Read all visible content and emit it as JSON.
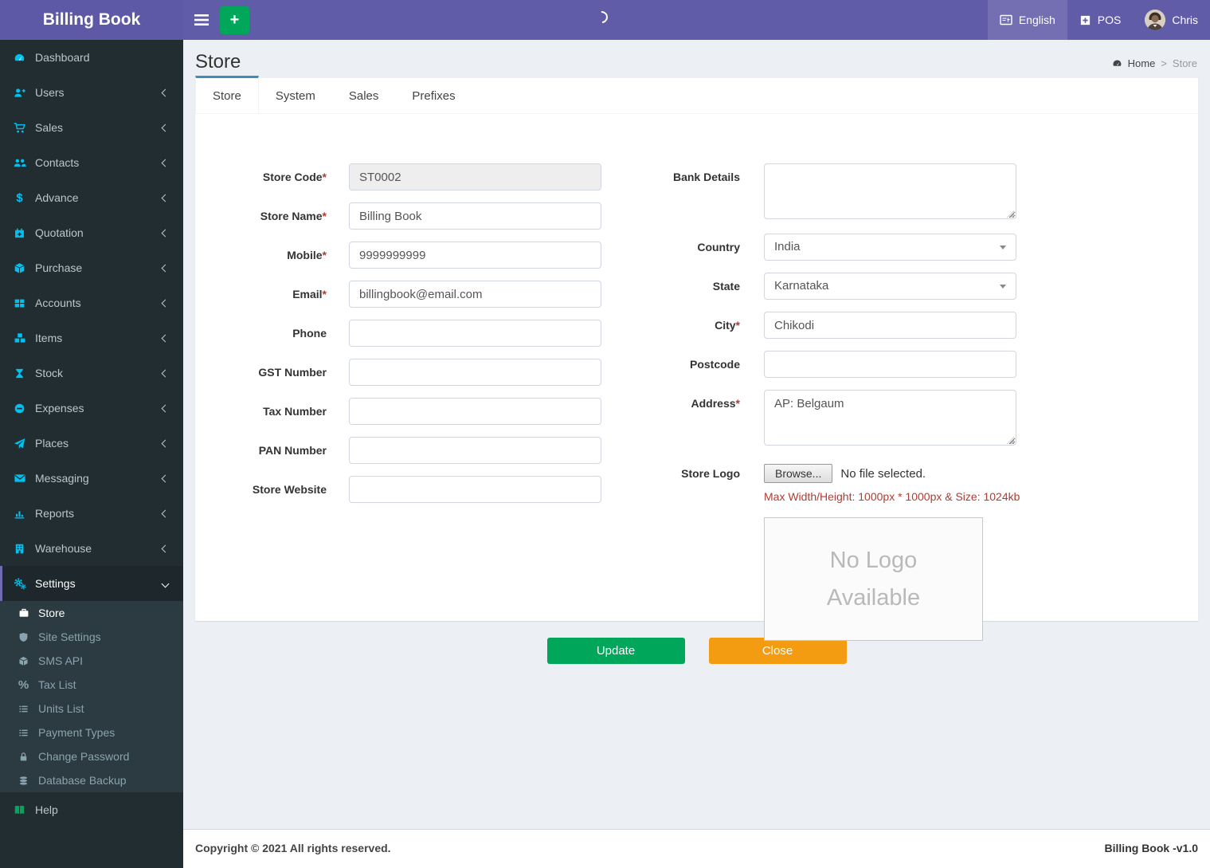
{
  "app": {
    "name": "Billing Book"
  },
  "header": {
    "language": {
      "label": "English",
      "icon": "language-icon"
    },
    "pos": {
      "label": "POS",
      "icon": "plus-square-icon"
    },
    "user": {
      "name": "Chris",
      "icon": "user-avatar"
    }
  },
  "sidebar": {
    "items": [
      {
        "label": "Dashboard",
        "icon": "tachometer-icon"
      },
      {
        "label": "Users",
        "icon": "user-plus-icon"
      },
      {
        "label": "Sales",
        "icon": "cart-icon"
      },
      {
        "label": "Contacts",
        "icon": "users-icon"
      },
      {
        "label": "Advance",
        "icon": "dollar-icon"
      },
      {
        "label": "Quotation",
        "icon": "calendar-plus-icon"
      },
      {
        "label": "Purchase",
        "icon": "cube-icon"
      },
      {
        "label": "Accounts",
        "icon": "grid-icon"
      },
      {
        "label": "Items",
        "icon": "cubes-icon"
      },
      {
        "label": "Stock",
        "icon": "hourglass-icon"
      },
      {
        "label": "Expenses",
        "icon": "minus-circle-icon"
      },
      {
        "label": "Places",
        "icon": "paper-plane-icon"
      },
      {
        "label": "Messaging",
        "icon": "envelope-icon"
      },
      {
        "label": "Reports",
        "icon": "bar-chart-icon"
      },
      {
        "label": "Warehouse",
        "icon": "building-icon"
      },
      {
        "label": "Settings",
        "icon": "gears-icon",
        "active": true,
        "expanded": true
      }
    ],
    "settings_submenu": [
      {
        "label": "Store",
        "icon": "briefcase-icon",
        "active": true
      },
      {
        "label": "Site Settings",
        "icon": "shield-icon"
      },
      {
        "label": "SMS API",
        "icon": "cube-icon"
      },
      {
        "label": "Tax List",
        "icon": "percent-icon"
      },
      {
        "label": "Units List",
        "icon": "list-icon"
      },
      {
        "label": "Payment Types",
        "icon": "list-icon"
      },
      {
        "label": "Change Password",
        "icon": "lock-icon"
      },
      {
        "label": "Database Backup",
        "icon": "database-icon"
      }
    ],
    "help": {
      "label": "Help",
      "icon": "book-icon"
    }
  },
  "page": {
    "title": "Store",
    "breadcrumb": {
      "home": "Home",
      "separator": ">",
      "current": "Store"
    },
    "tabs": [
      {
        "label": "Store",
        "active": true
      },
      {
        "label": "System"
      },
      {
        "label": "Sales"
      },
      {
        "label": "Prefixes"
      }
    ]
  },
  "form": {
    "left": [
      {
        "label": "Store Code",
        "req": "*",
        "value": "ST0002",
        "readonly": true
      },
      {
        "label": "Store Name",
        "req": "*",
        "value": "Billing Book"
      },
      {
        "label": "Mobile",
        "req": "*",
        "value": "9999999999"
      },
      {
        "label": "Email",
        "req": "*",
        "value": "billingbook@email.com"
      },
      {
        "label": "Phone",
        "value": ""
      },
      {
        "label": "GST Number",
        "value": ""
      },
      {
        "label": "Tax Number",
        "value": ""
      },
      {
        "label": "PAN Number",
        "value": ""
      },
      {
        "label": "Store Website",
        "value": ""
      }
    ],
    "right": {
      "bank_details": {
        "label": "Bank Details",
        "value": ""
      },
      "country": {
        "label": "Country",
        "value": "India"
      },
      "state": {
        "label": "State",
        "value": "Karnataka"
      },
      "city": {
        "label": "City",
        "req": "*",
        "value": "Chikodi"
      },
      "postcode": {
        "label": "Postcode",
        "value": ""
      },
      "address": {
        "label": "Address",
        "req": "*",
        "value": "AP: Belgaum"
      },
      "store_logo": {
        "label": "Store Logo",
        "browse_label": "Browse...",
        "file_status": "No file selected.",
        "note": "Max Width/Height: 1000px * 1000px & Size: 1024kb",
        "placeholder_text": "No Logo Available"
      }
    },
    "buttons": {
      "update": "Update",
      "close": "Close"
    }
  },
  "footer": {
    "copyright": "Copyright © 2021 All rights reserved.",
    "version": "Billing Book -v1.0"
  },
  "colors": {
    "accent_purple": "#605ca8",
    "sidebar_dark": "#222d32",
    "icon_cyan": "#00c0ef",
    "success_green": "#00a65a",
    "warning_orange": "#f39c12",
    "tab_active_border": "#3c8dbc",
    "danger_red": "#b23b32"
  }
}
